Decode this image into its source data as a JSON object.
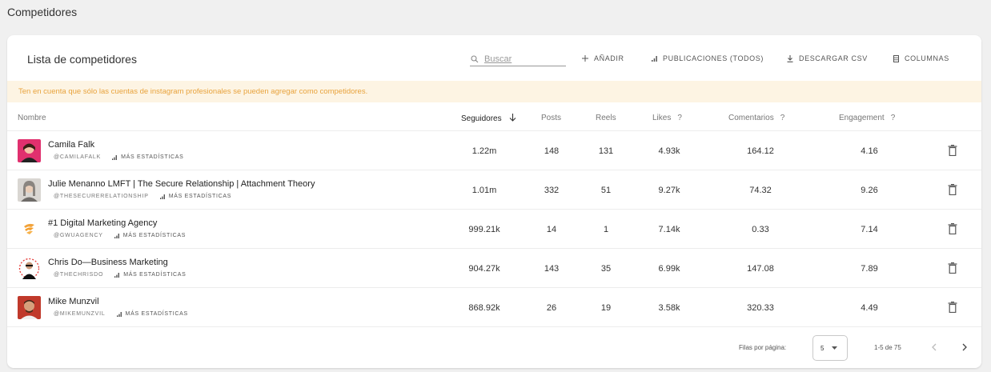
{
  "page": {
    "title": "Competidores"
  },
  "card": {
    "title": "Lista de competidores"
  },
  "toolbar": {
    "search_placeholder": "Buscar",
    "add_label": "AÑADIR",
    "publications_label": "PUBLICACIONES (TODOS)",
    "download_label": "DESCARGAR CSV",
    "columns_label": "COLUMNAS"
  },
  "notice": "Ten en cuenta que sólo las cuentas de instagram profesionales se pueden agregar como competidores.",
  "columns": {
    "name": "Nombre",
    "followers": "Seguidores",
    "posts": "Posts",
    "reels": "Reels",
    "likes": "Likes",
    "comments": "Comentarios",
    "engagement": "Engagement",
    "help_mark": "?"
  },
  "rows": [
    {
      "name": "Camila Falk",
      "handle": "@CAMILAFALK",
      "stats_link": "MÁS ESTADÍSTICAS",
      "followers": "1.22m",
      "posts": "148",
      "reels": "131",
      "likes": "4.93k",
      "comments": "164.12",
      "engagement": "4.16"
    },
    {
      "name": "Julie Menanno LMFT | The Secure Relationship | Attachment Theory",
      "handle": "@THESECURERELATIONSHIP",
      "stats_link": "MÁS ESTADÍSTICAS",
      "followers": "1.01m",
      "posts": "332",
      "reels": "51",
      "likes": "9.27k",
      "comments": "74.32",
      "engagement": "9.26"
    },
    {
      "name": "#1 Digital Marketing Agency",
      "handle": "@GWUAGENCY",
      "stats_link": "MÁS ESTADÍSTICAS",
      "followers": "999.21k",
      "posts": "14",
      "reels": "1",
      "likes": "7.14k",
      "comments": "0.33",
      "engagement": "7.14"
    },
    {
      "name": "Chris Do—Business Marketing",
      "handle": "@THECHRISDO",
      "stats_link": "MÁS ESTADÍSTICAS",
      "followers": "904.27k",
      "posts": "143",
      "reels": "35",
      "likes": "6.99k",
      "comments": "147.08",
      "engagement": "7.89"
    },
    {
      "name": "Mike Munzvil",
      "handle": "@MIKEMUNZVIL",
      "stats_link": "MÁS ESTADÍSTICAS",
      "followers": "868.92k",
      "posts": "26",
      "reels": "19",
      "likes": "3.58k",
      "comments": "320.33",
      "engagement": "4.49"
    }
  ],
  "pagination": {
    "rows_per_page_label": "Filas por página:",
    "rows_per_page_value": "5",
    "range_label": "1-5 de 75"
  },
  "colors": {
    "notice_bg": "#fdf4e3",
    "notice_text": "#e8a33d",
    "page_bg": "#f0f0f0"
  }
}
